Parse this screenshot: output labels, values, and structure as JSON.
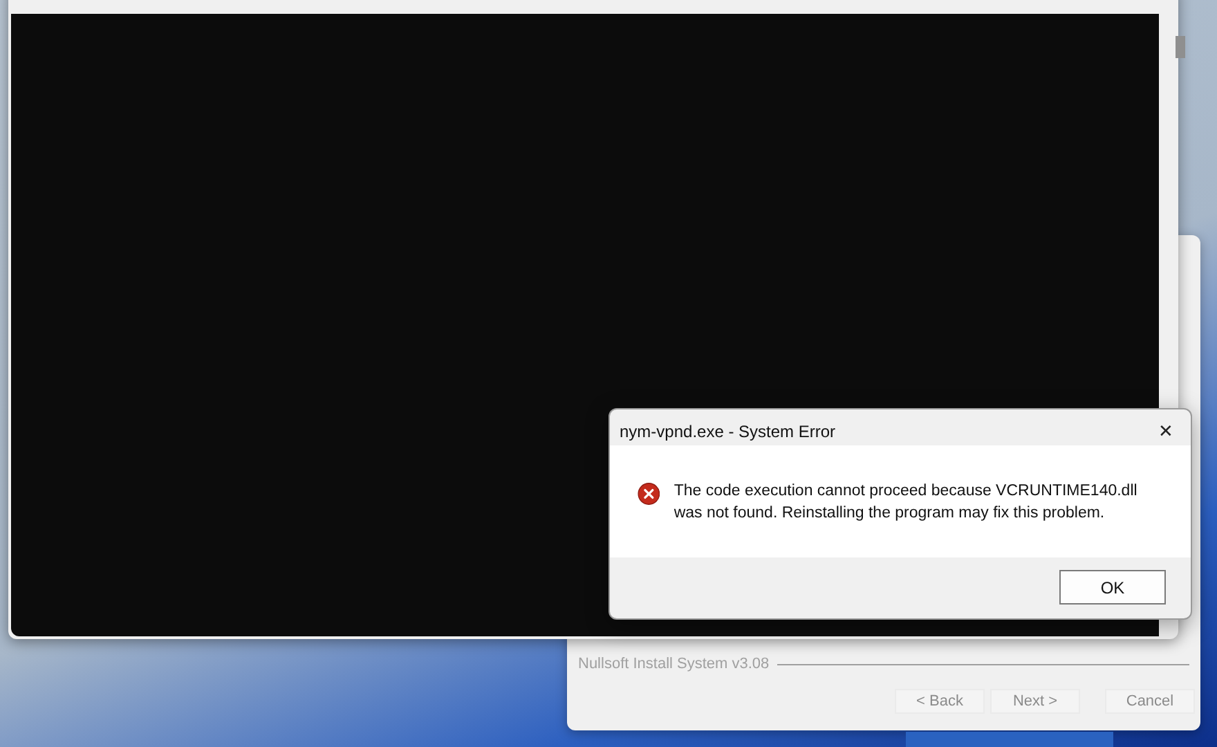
{
  "installer": {
    "branding": "Nullsoft Install System v3.08",
    "buttons": [
      {
        "label": "< Back"
      },
      {
        "label": "Next >"
      },
      {
        "label": "Cancel"
      }
    ]
  },
  "error_dialog": {
    "title": "nym-vpnd.exe - System Error",
    "close": "✕",
    "message": "The code execution cannot proceed because VCRUNTIME140.dll was not found. Reinstalling the program may fix this problem.",
    "button": "OK"
  }
}
